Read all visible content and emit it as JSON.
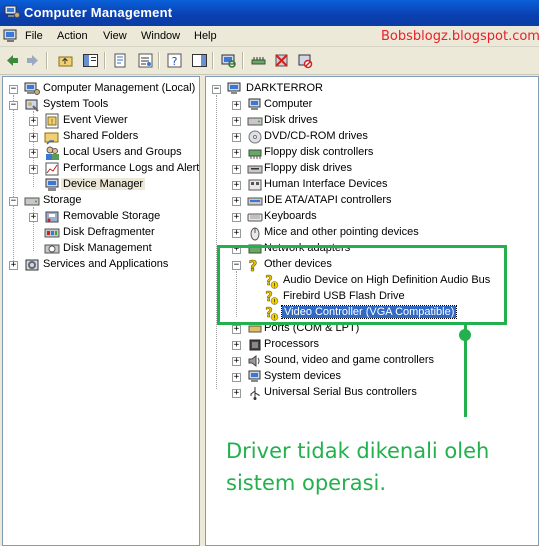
{
  "window": {
    "title": "Computer Management"
  },
  "menu": {
    "items": [
      "File",
      "Action",
      "View",
      "Window",
      "Help"
    ]
  },
  "watermark": "Bobsblogz.blogspot.com",
  "left_tree": {
    "root": "Computer Management (Local)",
    "system_tools": "System Tools",
    "event_viewer": "Event Viewer",
    "shared_folders": "Shared Folders",
    "local_users": "Local Users and Groups",
    "perf_logs": "Performance Logs and Alerts",
    "device_manager": "Device Manager",
    "storage": "Storage",
    "removable": "Removable Storage",
    "defrag": "Disk Defragmenter",
    "disk_mgmt": "Disk Management",
    "services": "Services and Applications"
  },
  "right_tree": {
    "root": "DARKTERROR",
    "items": [
      "Computer",
      "Disk drives",
      "DVD/CD-ROM drives",
      "Floppy disk controllers",
      "Floppy disk drives",
      "Human Interface Devices",
      "IDE ATA/ATAPI controllers",
      "Keyboards",
      "Mice and other pointing devices",
      "Network adapters"
    ],
    "other_devices": "Other devices",
    "other_children": [
      "Audio Device on High Definition Audio Bus",
      "Firebird USB Flash Drive",
      "Video Controller (VGA Compatible)"
    ],
    "after": [
      "Ports (COM & LPT)",
      "Processors",
      "Sound, video and game controllers",
      "System devices",
      "Universal Serial Bus controllers"
    ]
  },
  "annotation": {
    "text": "Driver tidak dikenali oleh sistem operasi."
  },
  "colors": {
    "accent": "#22b14c",
    "selection": "#316ac5",
    "watermark": "#e8202a"
  }
}
